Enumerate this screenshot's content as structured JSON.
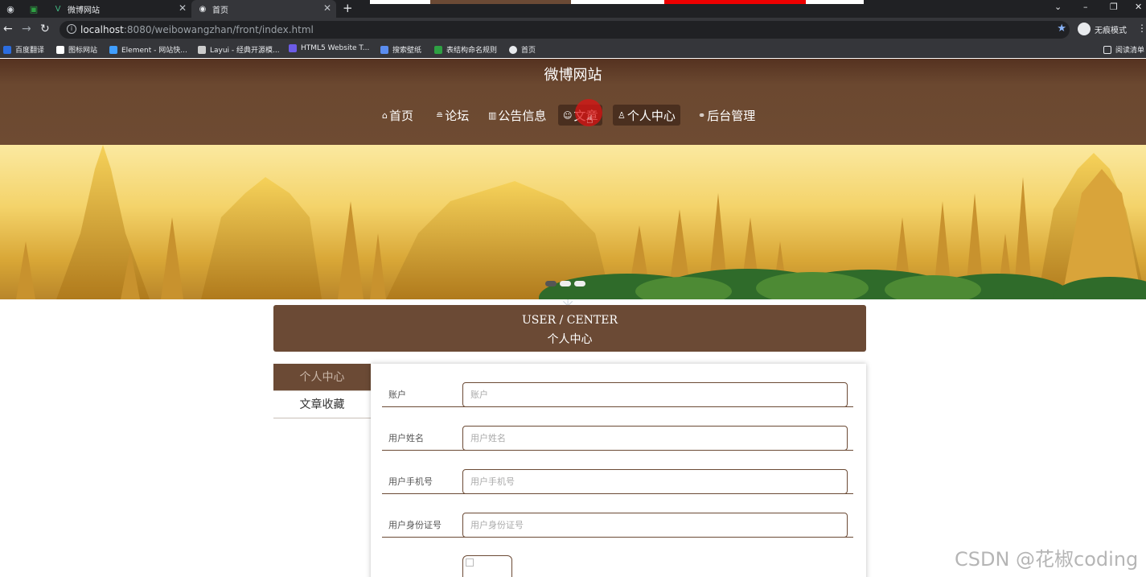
{
  "browser": {
    "tabs": [
      {
        "title": "微博网站",
        "active": false
      },
      {
        "title": "首页",
        "active": true
      }
    ],
    "new_tab_symbol": "+",
    "url": {
      "host": "localhost",
      "rest": ":8080/weibowangzhan/front/index.html"
    },
    "incognito_label": "无痕模式",
    "bookmarks": [
      {
        "label": "百度翻译",
        "icon": "translate-icon",
        "color": "#2b6de0"
      },
      {
        "label": "图标网站",
        "icon": "flag-icon",
        "color": "#ffffff"
      },
      {
        "label": "Element - 网站快...",
        "icon": "element-icon",
        "color": "#409eff"
      },
      {
        "label": "Layui - 经典开源模...",
        "icon": "layui-icon",
        "color": "#cccccc"
      },
      {
        "label": "HTML5 Website T...",
        "icon": "html5-icon",
        "color": "#6c5ce7"
      },
      {
        "label": "搜索壁纸",
        "icon": "wallpaper-icon",
        "color": "#5b8def"
      },
      {
        "label": "表结构命名规则",
        "icon": "table-icon",
        "color": "#2ea043"
      },
      {
        "label": "首页",
        "icon": "globe-icon",
        "color": "#e8eaed"
      },
      {
        "label": "阅读清单",
        "icon": "reading-list-icon",
        "color": "#e8eaed"
      }
    ]
  },
  "site": {
    "title": "微博网站",
    "nav": [
      {
        "label": "首页",
        "icon": "home-icon",
        "glyph": "⌂"
      },
      {
        "label": "论坛",
        "icon": "forum-icon",
        "glyph": "≘"
      },
      {
        "label": "公告信息",
        "icon": "notice-icon",
        "glyph": "▥"
      },
      {
        "label": "文章",
        "icon": "article-icon",
        "glyph": "☺"
      },
      {
        "label": "个人中心",
        "icon": "user-icon",
        "glyph": "♙"
      },
      {
        "label": "后台管理",
        "icon": "link-icon",
        "glyph": "⚭"
      }
    ],
    "carousel_dots": 3,
    "loader_glyph": "✳"
  },
  "user_center": {
    "title_en": "USER / CENTER",
    "title_cn": "个人中心",
    "menu": [
      {
        "label": "个人中心",
        "active": true
      },
      {
        "label": "文章收藏",
        "active": false
      }
    ],
    "fields": [
      {
        "label": "账户",
        "placeholder": "账户"
      },
      {
        "label": "用户姓名",
        "placeholder": "用户姓名"
      },
      {
        "label": "用户手机号",
        "placeholder": "用户手机号"
      },
      {
        "label": "用户身份证号",
        "placeholder": "用户身份证号"
      }
    ]
  },
  "watermark": "CSDN @花椒coding",
  "colors": {
    "brand": "#6b4a35",
    "header_dark": "#553220",
    "accent_red": "#dc1414"
  }
}
